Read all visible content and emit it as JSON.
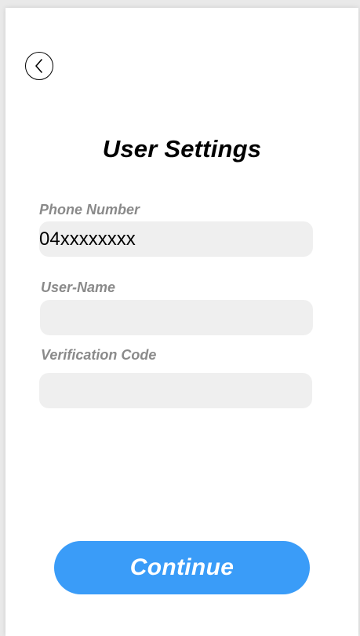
{
  "header": {
    "title": "User Settings",
    "back_icon": "chevron-left-icon"
  },
  "form": {
    "phone": {
      "label": "Phone Number",
      "value": "04xxxxxxxx",
      "placeholder": ""
    },
    "username": {
      "label": "User-Name",
      "value": "",
      "placeholder": ""
    },
    "verification": {
      "label": "Verification Code",
      "value": "",
      "placeholder": ""
    }
  },
  "actions": {
    "continue_label": "Continue"
  },
  "colors": {
    "accent": "#3a9cf8",
    "input_background": "#efefef",
    "label_text": "#8a8a8a"
  }
}
